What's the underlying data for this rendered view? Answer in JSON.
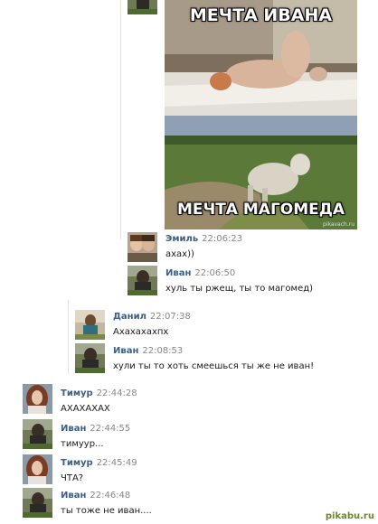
{
  "meme": {
    "top_caption": "МЕЧТА ИВАНА",
    "bottom_caption": "МЕЧТА МАГОМЕДА",
    "watermark": "pikavach.ru"
  },
  "messages": [
    {
      "name": "Эмиль",
      "time": "22:06:23",
      "text": "ахах))"
    },
    {
      "name": "Иван",
      "time": "22:06:50",
      "text": "хуль ты ржещ, ты то магомед)"
    },
    {
      "name": "Данил",
      "time": "22:07:38",
      "text": "Ахахахахпх"
    },
    {
      "name": "Иван",
      "time": "22:08:53",
      "text": "хули ты то хоть смеешься ты же не иван!"
    },
    {
      "name": "Тимур",
      "time": "22:44:28",
      "text": "АХАХАХАХ"
    },
    {
      "name": "Иван",
      "time": "22:44:55",
      "text": "тимуур..."
    },
    {
      "name": "Тимур",
      "time": "22:45:49",
      "text": "ЧТА?"
    },
    {
      "name": "Иван",
      "time": "22:46:48",
      "text": "ты тоже не иван...."
    }
  ],
  "footer": {
    "site": "pikabu.ru"
  }
}
